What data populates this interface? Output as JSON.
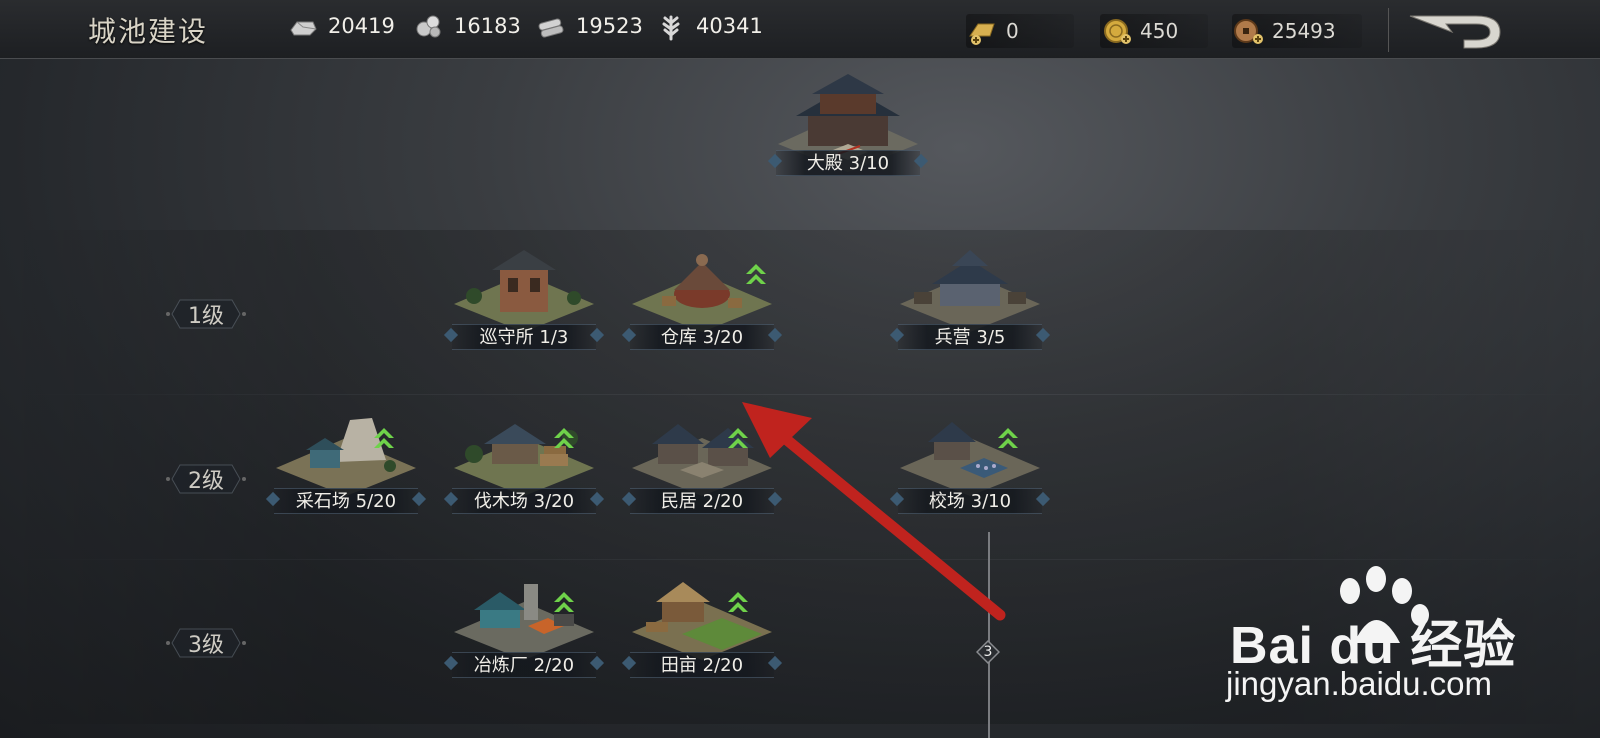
{
  "header": {
    "title": "城池建设",
    "resources": [
      {
        "icon": "silver-ingot-icon",
        "value": "20419"
      },
      {
        "icon": "ore-icon",
        "value": "16183"
      },
      {
        "icon": "timber-icon",
        "value": "19523"
      },
      {
        "icon": "grain-icon",
        "value": "40341"
      }
    ],
    "currencies": [
      {
        "icon": "gold-bar-plus-icon",
        "value": "0"
      },
      {
        "icon": "gold-coin-plus-icon",
        "value": "450"
      },
      {
        "icon": "copper-coin-plus-icon",
        "value": "25493"
      }
    ],
    "back_icon": "back-arrow-icon"
  },
  "levels": [
    {
      "label": "1级"
    },
    {
      "label": "2级"
    },
    {
      "label": "3级"
    }
  ],
  "buildings": {
    "palace": {
      "label": "大殿 3/10",
      "upgrade": false
    },
    "patrol": {
      "label": "巡守所 1/3",
      "upgrade": false
    },
    "warehouse": {
      "label": "仓库 3/20",
      "upgrade": true
    },
    "barracks": {
      "label": "兵营 3/5",
      "upgrade": false
    },
    "quarry": {
      "label": "采石场 5/20",
      "upgrade": true
    },
    "lumber": {
      "label": "伐木场 3/20",
      "upgrade": true
    },
    "housing": {
      "label": "民居 2/20",
      "upgrade": true
    },
    "training": {
      "label": "校场 3/10",
      "upgrade": true
    },
    "smelter": {
      "label": "冶炼厂 2/20",
      "upgrade": true
    },
    "farm": {
      "label": "田亩 2/20",
      "upgrade": true
    }
  },
  "tree_node": {
    "value": "3"
  },
  "colors": {
    "accent_upgrade": "#7fd35a",
    "annotation_arrow": "#c0231e"
  },
  "watermark": {
    "brand": "Bai du 经验",
    "url": "jingyan.baidu.com"
  }
}
